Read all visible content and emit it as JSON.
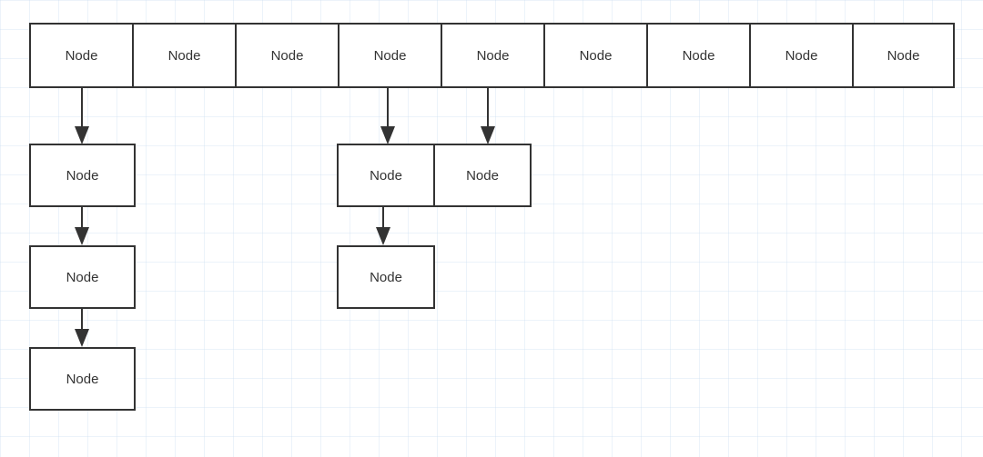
{
  "top_row": {
    "cells": [
      "Node",
      "Node",
      "Node",
      "Node",
      "Node",
      "Node",
      "Node",
      "Node",
      "Node"
    ]
  },
  "left_chain": {
    "n1": "Node",
    "n2": "Node",
    "n3": "Node"
  },
  "mid_group": {
    "left": "Node",
    "right": "Node",
    "below": "Node"
  }
}
